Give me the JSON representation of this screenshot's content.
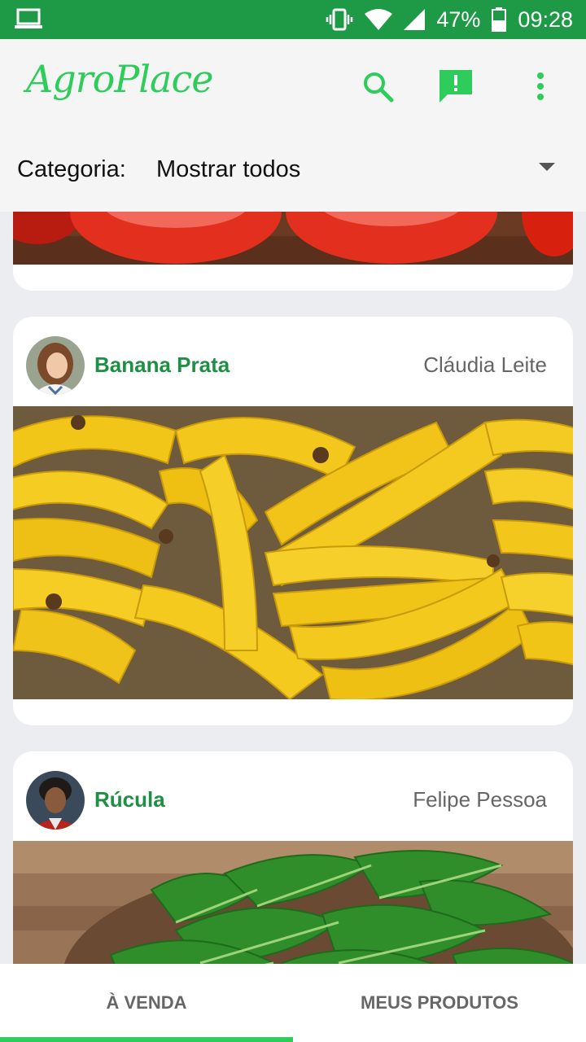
{
  "status_bar": {
    "battery": "47%",
    "time": "09:28"
  },
  "app": {
    "title": "AgroPlace"
  },
  "category": {
    "label": "Categoria:",
    "value": "Mostrar todos"
  },
  "icons": {
    "search": "search-icon",
    "alert": "alert-chat-icon",
    "more": "more-vert-icon",
    "dropdown": "dropdown-arrow-icon"
  },
  "products": [
    {
      "name": "Banana Prata",
      "seller": "Cláudia Leite"
    },
    {
      "name": "Rúcula",
      "seller": "Felipe Pessoa"
    }
  ],
  "tabs": [
    {
      "label": "À VENDA",
      "active": true
    },
    {
      "label": "MEUS PRODUTOS",
      "active": false
    }
  ],
  "colors": {
    "primary": "#1e9a47",
    "accent": "#2ecc5b",
    "product_name": "#1e8f45"
  }
}
